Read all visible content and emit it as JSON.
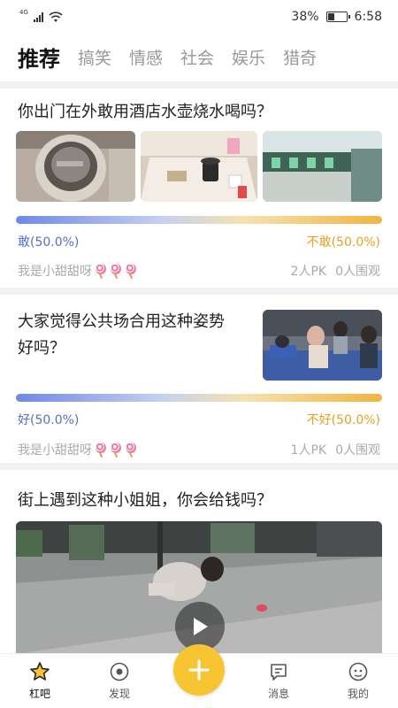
{
  "status_bar": {
    "network": "4G",
    "battery_percent": "38%",
    "battery_level": 0.38,
    "time": "6:58"
  },
  "tabs": [
    "推荐",
    "搞笑",
    "情感",
    "社会",
    "娱乐",
    "猎奇"
  ],
  "active_tab": "推荐",
  "posts": [
    {
      "title": "你出门在外敢用酒店水壶烧水喝吗？",
      "option_left": "敢(50.0%)",
      "option_right": "不敢(50.0%)",
      "split": 0.5,
      "author": "我是小甜甜呀",
      "pk": "2人PK",
      "watchers": "0人围观"
    },
    {
      "title_line1": "大家觉得公共场合用这种姿势",
      "title_line2": "好吗？",
      "option_left": "好(50.0%)",
      "option_right": "不好(50.0%)",
      "split": 0.5,
      "author": "我是小甜甜呀",
      "pk": "1人PK",
      "watchers": "0人围观"
    },
    {
      "title": "街上遇到这种小姐姐，你会给钱吗？"
    }
  ],
  "bottom_nav": [
    {
      "label": "杠吧",
      "icon": "star-icon"
    },
    {
      "label": "发现",
      "icon": "discover-icon"
    },
    {
      "label": "",
      "icon": "plus-icon"
    },
    {
      "label": "消息",
      "icon": "message-icon"
    },
    {
      "label": "我的",
      "icon": "profile-icon"
    }
  ],
  "colors": {
    "accent": "#f7c531",
    "left_option": "#5670c9",
    "right_option": "#e6a123"
  }
}
